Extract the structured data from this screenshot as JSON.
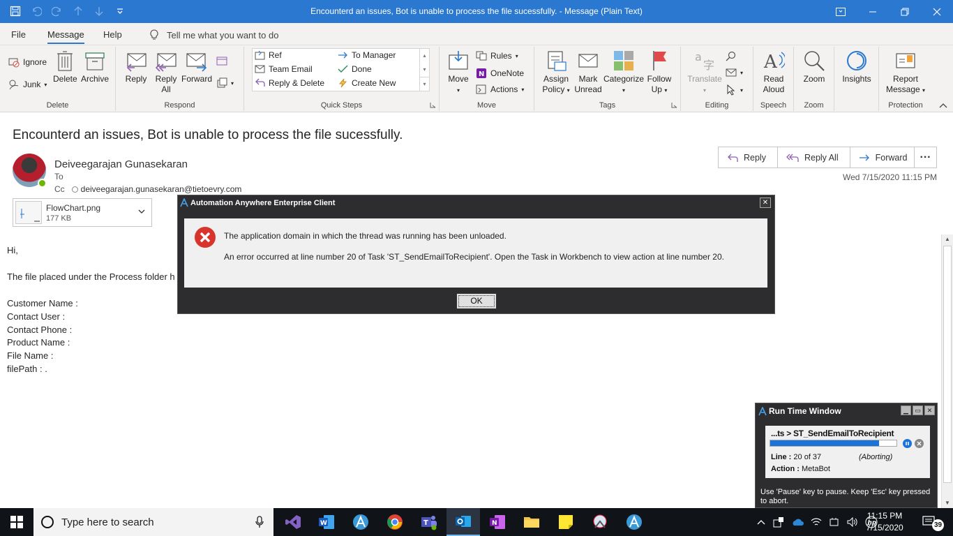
{
  "window": {
    "title": "Encounterd an issues, Bot is unable to process the file sucessfully.  -  Message (Plain Text)"
  },
  "menu": {
    "tabs": [
      {
        "label": "File"
      },
      {
        "label": "Message",
        "active": true
      },
      {
        "label": "Help"
      }
    ],
    "tell_me": "Tell me what you want to do"
  },
  "ribbon": {
    "delete_group": {
      "label": "Delete",
      "ignore": "Ignore",
      "junk": "Junk",
      "delete": "Delete",
      "archive": "Archive"
    },
    "respond_group": {
      "label": "Respond",
      "reply": "Reply",
      "reply_all_1": "Reply",
      "reply_all_2": "All",
      "forward": "Forward"
    },
    "quick_steps": {
      "label": "Quick Steps",
      "items": [
        "Ref",
        "Team Email",
        "Reply & Delete",
        "To Manager",
        "Done",
        "Create New"
      ]
    },
    "move_group": {
      "label": "Move",
      "move": "Move",
      "rules": "Rules",
      "onenote": "OneNote",
      "actions": "Actions"
    },
    "tags_group": {
      "label": "Tags",
      "assign_1": "Assign",
      "assign_2": "Policy",
      "mark_1": "Mark",
      "mark_2": "Unread",
      "categorize": "Categorize",
      "follow_1": "Follow",
      "follow_2": "Up"
    },
    "editing_group": {
      "label": "Editing",
      "translate": "Translate"
    },
    "speech_group": {
      "label": "Speech",
      "read_1": "Read",
      "read_2": "Aloud"
    },
    "zoom_group": {
      "label": "Zoom",
      "zoom": "Zoom"
    },
    "insights": "Insights",
    "protection_group": {
      "label": "Protection",
      "report_1": "Report",
      "report_2": "Message"
    }
  },
  "email": {
    "subject": "Encounterd an issues, Bot is unable to process the file sucessfully.",
    "sender": "Deiveegarajan Gunasekaran",
    "to_label": "To",
    "cc_label": "Cc",
    "cc_address": "deiveegarajan.gunasekaran@tietoevry.com",
    "datetime": "Wed 7/15/2020 11:15 PM",
    "attachment": {
      "name": "FlowChart.png",
      "size": "177 KB"
    },
    "actions": {
      "reply": "Reply",
      "reply_all": "Reply All",
      "forward": "Forward"
    },
    "body": [
      "Hi,",
      "The file placed under the Process folder h",
      "Customer Name :",
      "Contact User :",
      "Contact Phone :",
      "Product Name :",
      "File Name :",
      "filePath : ."
    ]
  },
  "error_dialog": {
    "title": "Automation Anywhere Enterprise Client",
    "close": "✕",
    "message_1": "The application domain in which the thread was running has been unloaded.",
    "message_2": "An error occurred at line number 20 of Task 'ST_SendEmailToRecipient'. Open the Task in Workbench to view action at line number 20.",
    "ok": "OK"
  },
  "runtime_window": {
    "title": "Run Time Window",
    "task": "...ts > ST_SendEmailToRecipient",
    "progress_fraction": 0.86,
    "line_label": "Line :",
    "line_value": "20 of 37",
    "status": "(Aborting)",
    "action_label": "Action :",
    "action_value": "MetaBot",
    "hint": "Use 'Pause' key to pause. Keep 'Esc' key pressed to abort."
  },
  "taskbar": {
    "search_placeholder": "Type here to search",
    "time": "11:15 PM",
    "date": "7/15/2020",
    "notification_count": "39"
  },
  "colors": {
    "title_bar": "#2b78d0",
    "error_red": "#d9342b",
    "progress": "#1a73d9"
  }
}
